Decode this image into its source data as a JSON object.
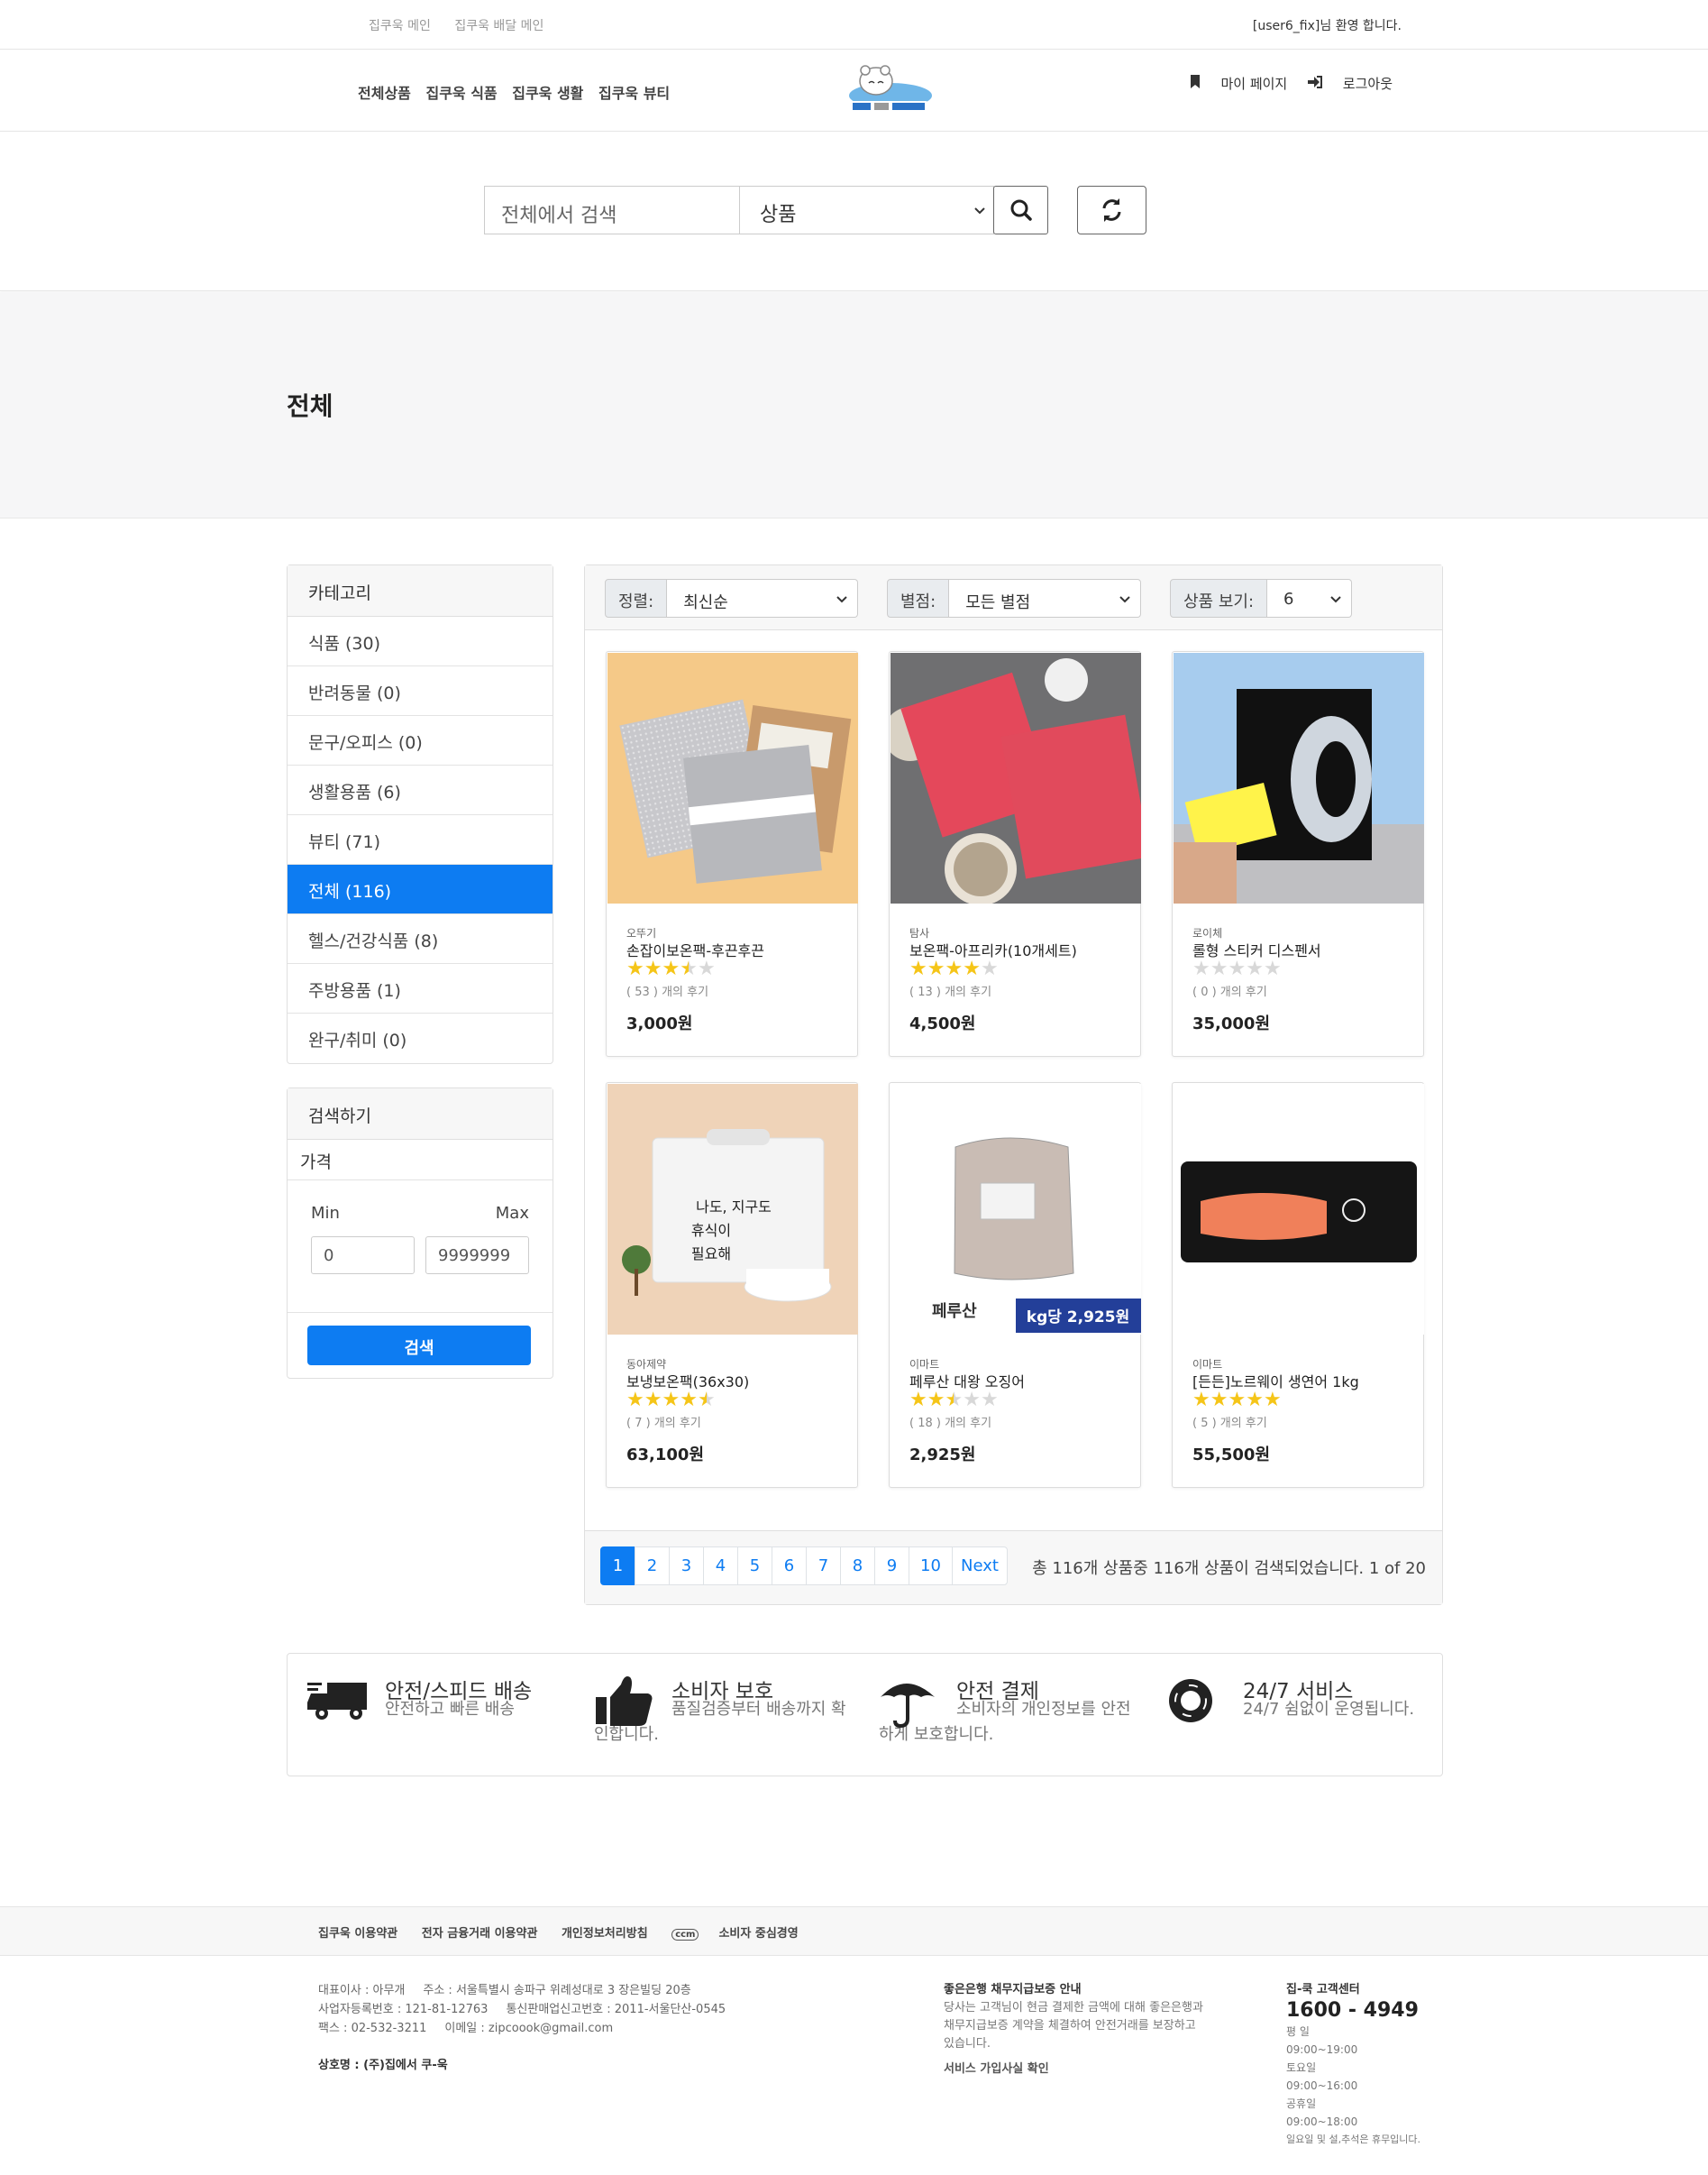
{
  "topbar": {
    "link1": "집쿠욱 메인",
    "link2": "집쿠욱 배달 메인",
    "welcome": "[user6_fix]님 환영 합니다."
  },
  "nav": {
    "categories": [
      "전체상품",
      "집쿠욱 식품",
      "집쿠욱 생활",
      "집쿠욱 뷰티"
    ],
    "mypage": "마이 페이지",
    "logout": "로그아웃"
  },
  "search": {
    "placeholder": "전체에서 검색",
    "select_value": "상품"
  },
  "page_title": "전체",
  "sidebar": {
    "category_title": "카테고리",
    "categories": [
      {
        "label": "식품 (30)"
      },
      {
        "label": "반려동물 (0)"
      },
      {
        "label": "문구/오피스 (0)"
      },
      {
        "label": "생활용품 (6)"
      },
      {
        "label": "뷰티 (71)"
      },
      {
        "label": "전체 (116)"
      },
      {
        "label": "헬스/건강식품 (8)"
      },
      {
        "label": "주방용품 (1)"
      },
      {
        "label": "완구/취미 (0)"
      }
    ],
    "active_index": 5,
    "search_title": "검색하기",
    "price_label": "가격",
    "min_label": "Min",
    "max_label": "Max",
    "min_value": "0",
    "max_value": "9999999",
    "search_button": "검색"
  },
  "toolbar": {
    "sort_label": "정렬:",
    "sort_value": "최신순",
    "rating_label": "별점:",
    "rating_value": "모든 별점",
    "view_label": "상품 보기:",
    "view_value": "6"
  },
  "products": [
    {
      "brand": "오뚜기",
      "name": "손잡이보온팩-후끈후끈",
      "rating": 3.5,
      "reviews": "( 53 ) 개의 후기",
      "price": "3,000원",
      "image": "silver-insulated-bags"
    },
    {
      "brand": "탐사",
      "name": "보온팩-아프리카(10개세트)",
      "rating": 4,
      "reviews": "( 13 ) 개의 후기",
      "price": "4,500원",
      "image": "red-insulated-bags"
    },
    {
      "brand": "로이체",
      "name": "롤형 스티커 디스펜서",
      "rating": 0,
      "reviews": "( 0 ) 개의 후기",
      "price": "35,000원",
      "image": "sticker-dispenser"
    },
    {
      "brand": "동아제약",
      "name": "보냉보온팩(36x30)",
      "rating": 4.5,
      "reviews": "( 7 ) 개의 후기",
      "price": "63,100원",
      "image": "white-cooler-bag",
      "image_text": [
        "나도, 지구도",
        "휴식이",
        "필요해"
      ]
    },
    {
      "brand": "이마트",
      "name": "페루산 대왕 오징어",
      "rating": 2.5,
      "reviews": "( 18 ) 개의 후기",
      "price": "2,925원",
      "image": "frozen-squid",
      "origin": "페루산",
      "unit_price": "kg당 2,925원"
    },
    {
      "brand": "이마트",
      "name": "[든든]노르웨이 생연어 1kg",
      "rating": 5,
      "reviews": "( 5 ) 개의 후기",
      "price": "55,500원",
      "image": "salmon-fillet"
    }
  ],
  "pagination": {
    "pages": [
      "1",
      "2",
      "3",
      "4",
      "5",
      "6",
      "7",
      "8",
      "9",
      "10",
      "Next"
    ],
    "active": "1",
    "info": "총 116개 상품중 116개 상품이 검색되었습니다. 1 of 20"
  },
  "features": [
    {
      "title": "안전/스피드 배송",
      "desc": "안전하고 빠른 배송",
      "icon": "truck-icon"
    },
    {
      "title": "소비자 보호",
      "desc": "품질검증부터 배송까지 확인합니다.",
      "icon": "thumbs-up-icon"
    },
    {
      "title": "안전 결제",
      "desc": "소비자의 개인정보를 안전하게 보호합니다.",
      "icon": "umbrella-icon"
    },
    {
      "title": "24/7 서비스",
      "desc": "24/7 쉼없이 운영됩니다.",
      "icon": "lifebuoy-icon"
    }
  ],
  "footer": {
    "links": [
      "집쿠욱 이용약관",
      "전자 금융거래 이용약관",
      "개인정보처리방침",
      "소비자 중심경영"
    ],
    "ccm_badge": "ccm",
    "ceo": "대표이사 : 아무개",
    "address": "주소 : 서울특별시 송파구 위례성대로 3 장은빌딩 20층",
    "biz_no": "사업자등록번호 : 121-81-12763",
    "mail_order": "통신판매업신고번호 : 2011-서울단산-0545",
    "fax": "팩스 : 02-532-3211",
    "email": "이메일 : zipcoook@gmail.com",
    "company": "상호명 : (주)집에서 쿠-욱",
    "bank_title": "좋은은행 채무지급보증 안내",
    "bank_desc": "당사는 고객님이 현금 결제한 금액에 대해 좋은은행과 채무지급보증 계약을 체결하여 안전거래를 보장하고 있습니다.",
    "bank_link": "서비스 가입사실 확인",
    "cs_title": "집-쿡 고객센터",
    "cs_phone": "1600 - 4949",
    "weekday_label": "평 일",
    "weekday_hours": "09:00~19:00",
    "saturday_label": "토요일",
    "saturday_hours": "09:00~16:00",
    "holiday_label": "공휴일",
    "holiday_hours": "09:00~18:00",
    "closed_note": "일요일 및 설,추석은 휴무입니다."
  }
}
